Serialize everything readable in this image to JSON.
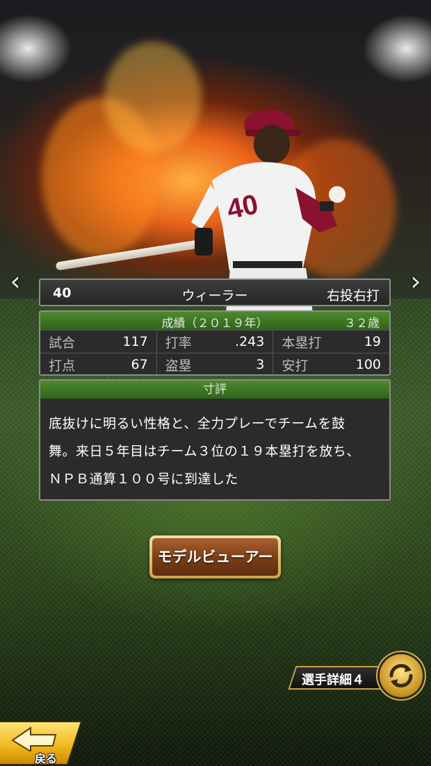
{
  "player": {
    "number": "40",
    "name": "ウィーラー",
    "handedness": "右投右打"
  },
  "stats": {
    "title": "成績（２０１９年）",
    "age": "３２歳",
    "rows": [
      [
        {
          "label": "試合",
          "value": "117"
        },
        {
          "label": "打率",
          "value": ".243"
        },
        {
          "label": "本塁打",
          "value": "19"
        }
      ],
      [
        {
          "label": "打点",
          "value": "67"
        },
        {
          "label": "盗塁",
          "value": "3"
        },
        {
          "label": "安打",
          "value": "100"
        }
      ]
    ]
  },
  "review": {
    "title": "寸評",
    "lines": [
      "底抜けに明るい性格と、全力プレーでチームを鼓",
      "舞。来日５年目はチーム３位の１９本塁打を放ち、",
      "ＮＰＢ通算１００号に到達した"
    ]
  },
  "buttons": {
    "model_viewer": "モデルビューアー",
    "player_detail": "選手詳細４",
    "back": "戻る"
  },
  "icons": {
    "prev": "chevron-left-icon",
    "next": "chevron-right-icon",
    "refresh": "refresh-icon",
    "back": "back-arrow-icon"
  },
  "colors": {
    "header_green": "#3f7a25",
    "panel_bg": "#2b2b2b",
    "button_brown": "#7a3d17",
    "gold": "#f0b51c"
  }
}
